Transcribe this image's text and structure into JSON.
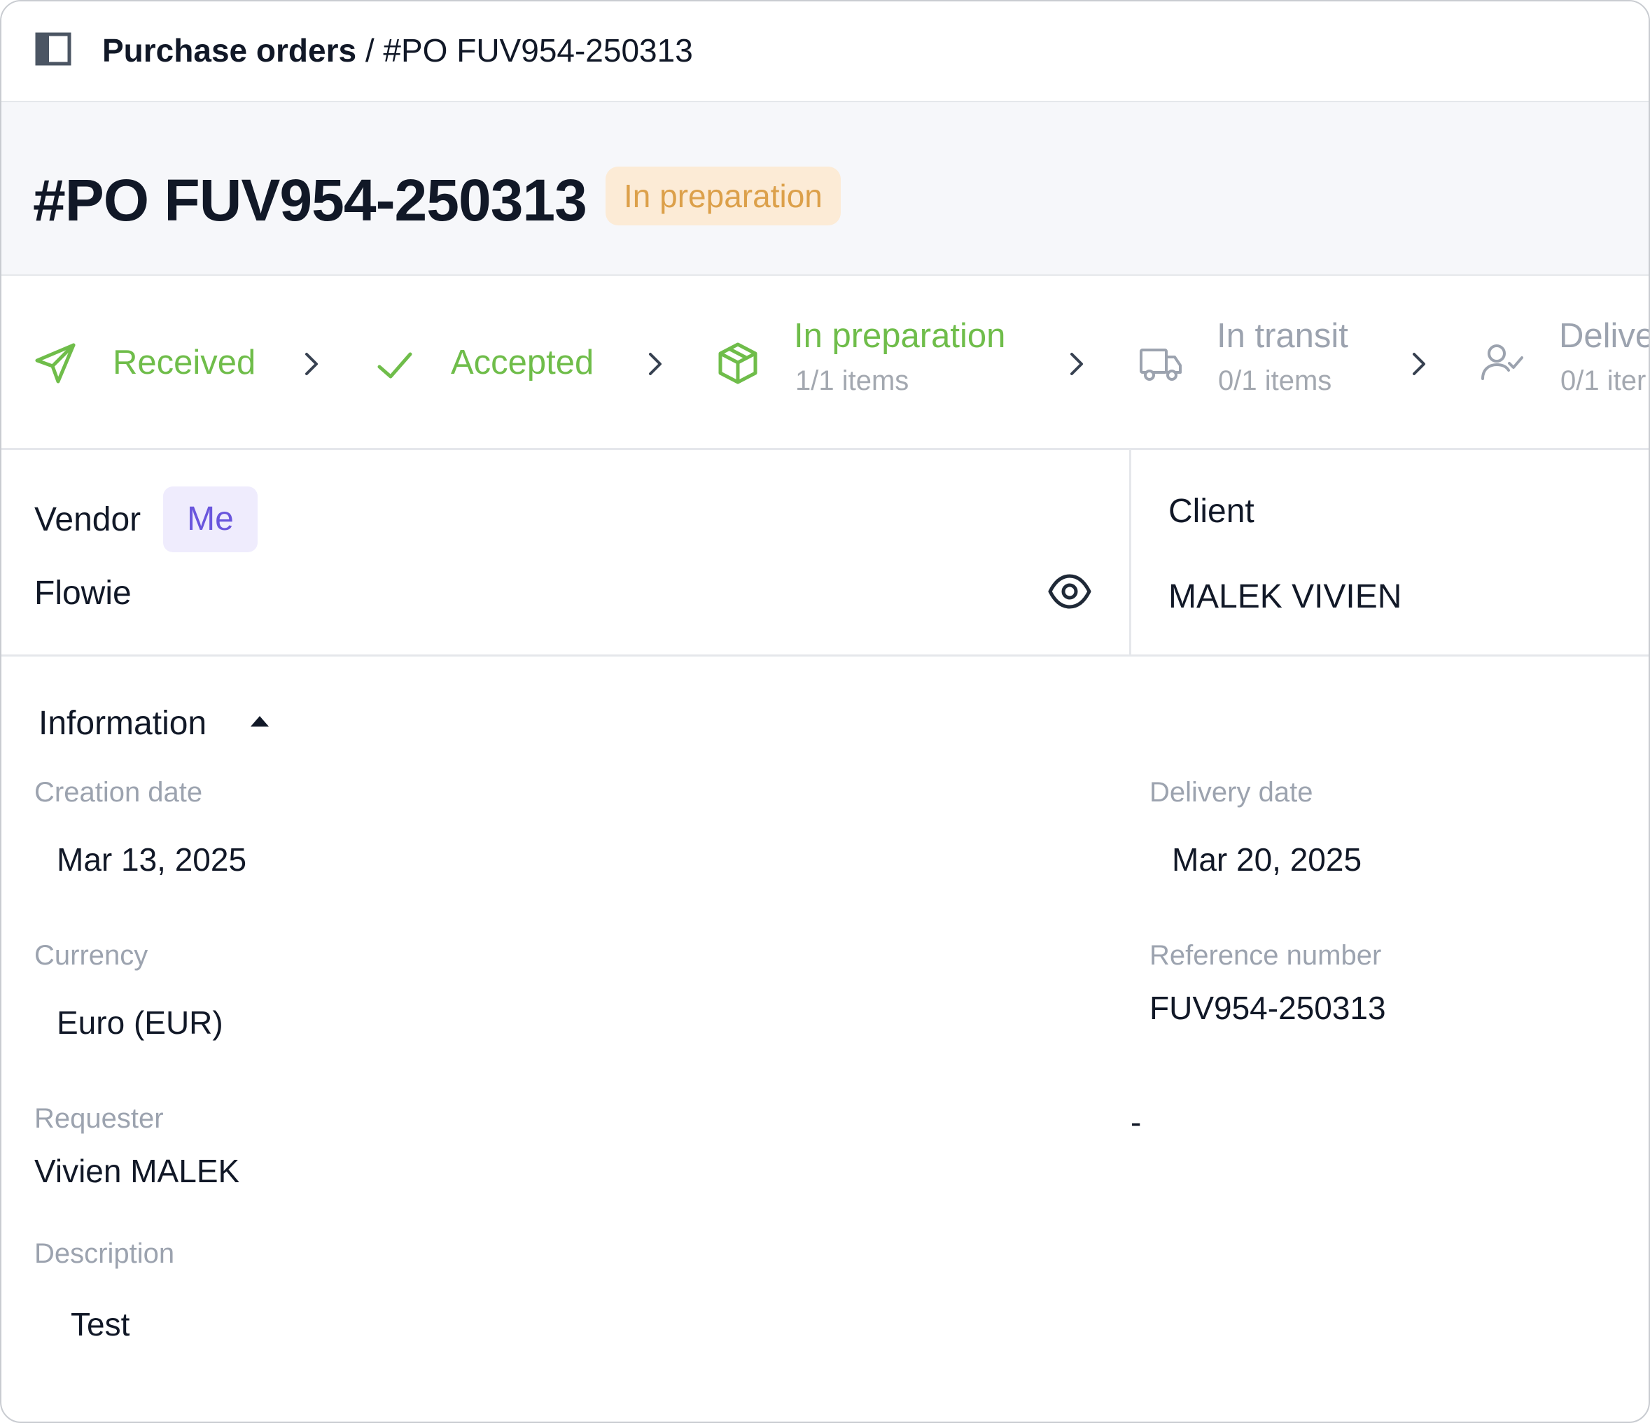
{
  "breadcrumb": {
    "parent": "Purchase orders",
    "separator": "/",
    "current": "#PO FUV954-250313"
  },
  "header": {
    "title": "#PO FUV954-250313",
    "status": "In preparation"
  },
  "steps": [
    {
      "label": "Received",
      "sub": "",
      "icon": "send-icon",
      "state": "done"
    },
    {
      "label": "Accepted",
      "sub": "",
      "icon": "check-icon",
      "state": "done"
    },
    {
      "label": "In preparation",
      "sub": "1/1 items",
      "icon": "package-icon",
      "state": "active"
    },
    {
      "label": "In transit",
      "sub": "0/1 items",
      "icon": "truck-icon",
      "state": "pending"
    },
    {
      "label": "Delive",
      "sub": "0/1 iter",
      "icon": "user-check-icon",
      "state": "pending"
    }
  ],
  "vendor": {
    "label": "Vendor",
    "badge": "Me",
    "name": "Flowie"
  },
  "client": {
    "label": "Client",
    "name": "MALEK VIVIEN"
  },
  "information": {
    "title": "Information",
    "fields": {
      "creation_date": {
        "label": "Creation date",
        "value": "Mar 13, 2025"
      },
      "delivery_date": {
        "label": "Delivery date",
        "value": "Mar 20, 2025"
      },
      "currency": {
        "label": "Currency",
        "value": "Euro (EUR)"
      },
      "reference_number": {
        "label": "Reference number",
        "value": "FUV954-250313"
      },
      "requester": {
        "label": "Requester",
        "value": "Vivien MALEK"
      },
      "empty_value": "-",
      "description": {
        "label": "Description",
        "value": "Test"
      }
    }
  },
  "colors": {
    "accent_green": "#6fbd4a",
    "status_orange": "#dca04a",
    "status_orange_bg": "#fcebd6",
    "me_purple": "#6a56dd",
    "me_purple_bg": "#efecfd",
    "muted_gray": "#9ca3af"
  }
}
